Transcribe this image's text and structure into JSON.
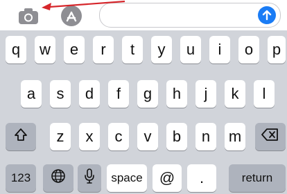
{
  "toolbar": {
    "camera_icon": "camera-icon",
    "appstore_icon": "app-store-icon",
    "send_icon": "send-arrow-up-icon",
    "field_value": "",
    "colors": {
      "send": "#1a7cf5",
      "annotation_arrow": "#d6262b",
      "icon_gray": "#8e8e93"
    }
  },
  "keyboard": {
    "row1": [
      "q",
      "w",
      "e",
      "r",
      "t",
      "y",
      "u",
      "i",
      "o",
      "p"
    ],
    "row2": [
      "a",
      "s",
      "d",
      "f",
      "g",
      "h",
      "j",
      "k",
      "l"
    ],
    "row3": [
      "z",
      "x",
      "c",
      "v",
      "b",
      "n",
      "m"
    ],
    "shift_icon": "shift-icon",
    "delete_icon": "delete-icon",
    "numbers_label": "123",
    "globe_icon": "globe-icon",
    "mic_icon": "microphone-icon",
    "space_label": "space",
    "at_label": "@",
    "dot_label": ".",
    "return_label": "return"
  }
}
